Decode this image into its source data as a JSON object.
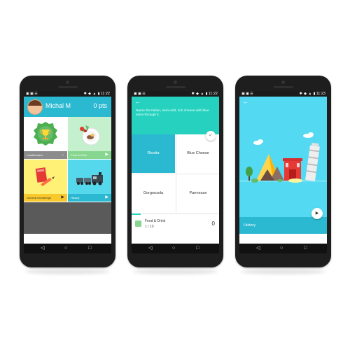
{
  "phones": [
    {
      "status": {
        "time": "11:22"
      },
      "header": {
        "name": "Michal M",
        "points": "0 pts"
      },
      "tiles": [
        {
          "label": "Leaderboard",
          "arrow": "→"
        },
        {
          "label": "Food & Drink",
          "arrow": "▶"
        },
        {
          "label": "General Knowledge",
          "arrow": "▶"
        },
        {
          "label": "History",
          "arrow": "▶"
        }
      ]
    },
    {
      "status": {
        "time": "11:22"
      },
      "question": "Name the Italian, semi-soft, rich cheese with blue veins through it.",
      "answers": [
        "Ricotta",
        "Blue Cheese",
        "Gorgonzola",
        "Parmesan"
      ],
      "footer": {
        "category": "Food & Drink",
        "count": "1 / 10",
        "score": "0"
      },
      "progress": 0.1
    },
    {
      "status": {
        "time": "11:23"
      },
      "category_label": "History"
    }
  ],
  "icons": {
    "back": "←",
    "check": "✓",
    "play": "▶",
    "nav_back": "◁",
    "nav_home": "○",
    "nav_recent": "□"
  },
  "colors": {
    "primary": "#2bb9d1",
    "teal": "#26d2bf",
    "green": "#87d68f",
    "yellow": "#fff176",
    "cyan": "#55d7ec"
  }
}
